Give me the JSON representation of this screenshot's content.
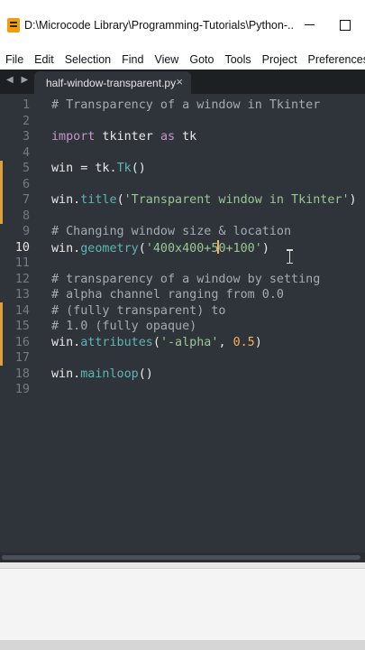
{
  "window": {
    "title": "D:\\Microcode Library\\Programming-Tutorials\\Python-...",
    "minimize_icon": "minimize-icon",
    "maximize_icon": "maximize-icon"
  },
  "menu": [
    "File",
    "Edit",
    "Selection",
    "Find",
    "View",
    "Goto",
    "Tools",
    "Project",
    "Preferences"
  ],
  "tab": {
    "label": "half-window-transparent.py",
    "close": "×",
    "nav": "◀ ▶"
  },
  "editor": {
    "active_line": 10,
    "lines": [
      {
        "n": "1",
        "tokens": [
          [
            "c-comment",
            "# Transparency of a window in Tkinter"
          ]
        ]
      },
      {
        "n": "2",
        "tokens": []
      },
      {
        "n": "3",
        "tokens": [
          [
            "c-kw",
            "import"
          ],
          [
            "",
            " tkinter "
          ],
          [
            "c-kw",
            "as"
          ],
          [
            "",
            " tk"
          ]
        ]
      },
      {
        "n": "4",
        "tokens": []
      },
      {
        "n": "5",
        "tokens": [
          [
            "",
            "win = tk."
          ],
          [
            "c-call",
            "Tk"
          ],
          [
            "",
            "()"
          ]
        ]
      },
      {
        "n": "6",
        "tokens": []
      },
      {
        "n": "7",
        "tokens": [
          [
            "",
            "win."
          ],
          [
            "c-call",
            "title"
          ],
          [
            "",
            "("
          ],
          [
            "c-str",
            "'Transparent window in Tkinter'"
          ],
          [
            "",
            ")"
          ]
        ]
      },
      {
        "n": "8",
        "tokens": []
      },
      {
        "n": "9",
        "tokens": [
          [
            "c-comment",
            "# Changing window size & location"
          ]
        ]
      },
      {
        "n": "10",
        "tokens": [
          [
            "",
            "win."
          ],
          [
            "c-call",
            "geometry"
          ],
          [
            "",
            "("
          ],
          [
            "c-str",
            "'400x400+5"
          ],
          [
            "caret",
            ""
          ],
          [
            "c-str",
            "0+100'"
          ],
          [
            "",
            ")"
          ]
        ]
      },
      {
        "n": "11",
        "tokens": []
      },
      {
        "n": "12",
        "tokens": [
          [
            "c-comment",
            "# transparency of a window by setting"
          ]
        ]
      },
      {
        "n": "13",
        "tokens": [
          [
            "c-comment",
            "# alpha channel ranging from 0.0"
          ]
        ]
      },
      {
        "n": "14",
        "tokens": [
          [
            "c-comment",
            "# (fully transparent) to"
          ]
        ]
      },
      {
        "n": "15",
        "tokens": [
          [
            "c-comment",
            "# 1.0 (fully opaque)"
          ]
        ]
      },
      {
        "n": "16",
        "tokens": [
          [
            "",
            "win."
          ],
          [
            "c-call",
            "attributes"
          ],
          [
            "",
            "("
          ],
          [
            "c-str",
            "'-alpha'"
          ],
          [
            "",
            ", "
          ],
          [
            "c-num",
            "0.5"
          ],
          [
            "",
            ")"
          ]
        ]
      },
      {
        "n": "17",
        "tokens": []
      },
      {
        "n": "18",
        "tokens": [
          [
            "",
            "win."
          ],
          [
            "c-call",
            "mainloop"
          ],
          [
            "",
            "()"
          ]
        ]
      },
      {
        "n": "19",
        "tokens": []
      }
    ]
  },
  "colors": {
    "editor_bg": "#2f343a",
    "comment": "#a3abb3",
    "keyword": "#c695c6",
    "function": "#5fb4b4",
    "string": "#99c794",
    "number": "#f9ae58",
    "modified_marker": "#e0a03a"
  }
}
